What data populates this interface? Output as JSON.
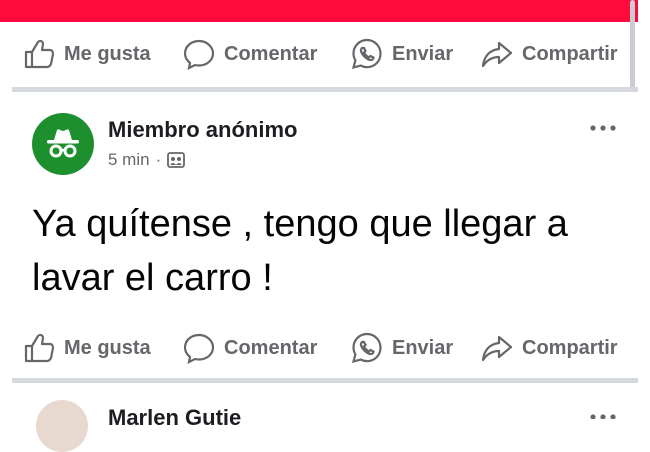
{
  "actions": {
    "like": "Me gusta",
    "comment": "Comentar",
    "send": "Enviar",
    "share": "Compartir"
  },
  "post": {
    "author": "Miembro anónimo",
    "time": "5 min",
    "separator": "·",
    "text": "Ya quítense , tengo que llegar a lavar el carro !"
  },
  "next_post": {
    "author": "Marlen Gutie"
  },
  "colors": {
    "banner": "#ff0a3c",
    "avatar": "#1d8f2d",
    "action_text": "#65676b"
  }
}
